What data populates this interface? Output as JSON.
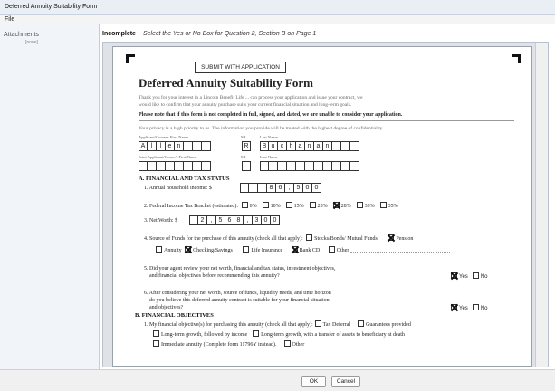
{
  "window": {
    "title": "Deferred Annuity Suitability Form"
  },
  "menu": {
    "file": "File"
  },
  "sidebar": {
    "heading": "Attachments",
    "sub": "[none]"
  },
  "status": {
    "state": "Incomplete",
    "message": "Select the Yes or No Box for Question 2, Section B on Page 1"
  },
  "form": {
    "submit": "SUBMIT WITH APPLICATION",
    "title": "Deferred Annuity Suitability Form",
    "intro": "Thank you for your interest in a Lincoln Benefit Life ... can process your application and issue your contract, we",
    "intro2": "would like to confirm that your annuity purchase suits your current financial situation and long-term goals.",
    "note": "Please note that if this form is not completed in full, signed, and dated, we are unable to consider your application.",
    "privacy": "Your privacy is a high priority to us. The information you provide will be treated with the highest degree of confidentiality.",
    "label_first": "Applicant/Owner's First Name",
    "label_mi": "MI",
    "label_last": "Last Name",
    "first_name": [
      "A",
      "l",
      "l",
      "e",
      "n",
      "",
      "",
      ""
    ],
    "mi": [
      "R"
    ],
    "last_name": [
      "B",
      "u",
      "c",
      "h",
      "a",
      "n",
      "a",
      "n",
      "",
      "",
      ""
    ],
    "label_joint_first": "Joint Applicant/Owner's First Name",
    "label_joint_mi": "MI",
    "label_joint_last": "Last Name",
    "sectionA": "A. FINANCIAL AND TAX STATUS",
    "q1": "1. Annual household income:",
    "currency": "$",
    "income": [
      "",
      "",
      "",
      "8",
      "6",
      ",",
      "5",
      "0",
      "0"
    ],
    "q2": "2. Federal Income Tax Bracket (estimated):",
    "brackets": [
      "0%",
      "10%",
      "15%",
      "25%",
      "28%",
      "33%",
      "35%"
    ],
    "bracket_selected": "28%",
    "q3": "3. Net Worth:",
    "networth": [
      "",
      "2",
      ",",
      "5",
      "6",
      "8",
      ",",
      "3",
      "0",
      "0"
    ],
    "q4": "4. Source of Funds for the purchase of this annuity (check all that apply):",
    "funds": {
      "stocks": "Stocks/Bonds/ Mutual Funds",
      "pension": "Pension",
      "annuity": "Annuity",
      "checking": "Checking/Savings",
      "life": "Life Insurance",
      "bankcd": "Bank CD",
      "other": "Other"
    },
    "q5a": "5. Did your agent review your net worth, financial and tax status, investment objectives,",
    "q5b": "and financial objectives before recommending this annuity?",
    "q6a": "6. After considering your net worth, source of funds, liquidity needs, and time horizon",
    "q6b": "do you believe this deferred annuity contract is suitable for your financial situation",
    "q6c": "and objectives?",
    "yes": "Yes",
    "no": "No",
    "sectionB": "B. FINANCIAL OBJECTIVES",
    "b1": "1. My financial objective(s) for purchasing this annuity (check all that apply):",
    "b_tax": "Tax Deferral",
    "b_guar": "Guarantees provided",
    "b_ltg_income": "Long-term growth, followed by income",
    "b_ltg_transfer": "Long-term growth, with a transfer of assets to beneficiary at death",
    "b_immediate": "Immediate annuity (Complete form 11796Y instead).",
    "b_other": "Other"
  },
  "buttons": {
    "ok": "OK",
    "cancel": "Cancel"
  }
}
